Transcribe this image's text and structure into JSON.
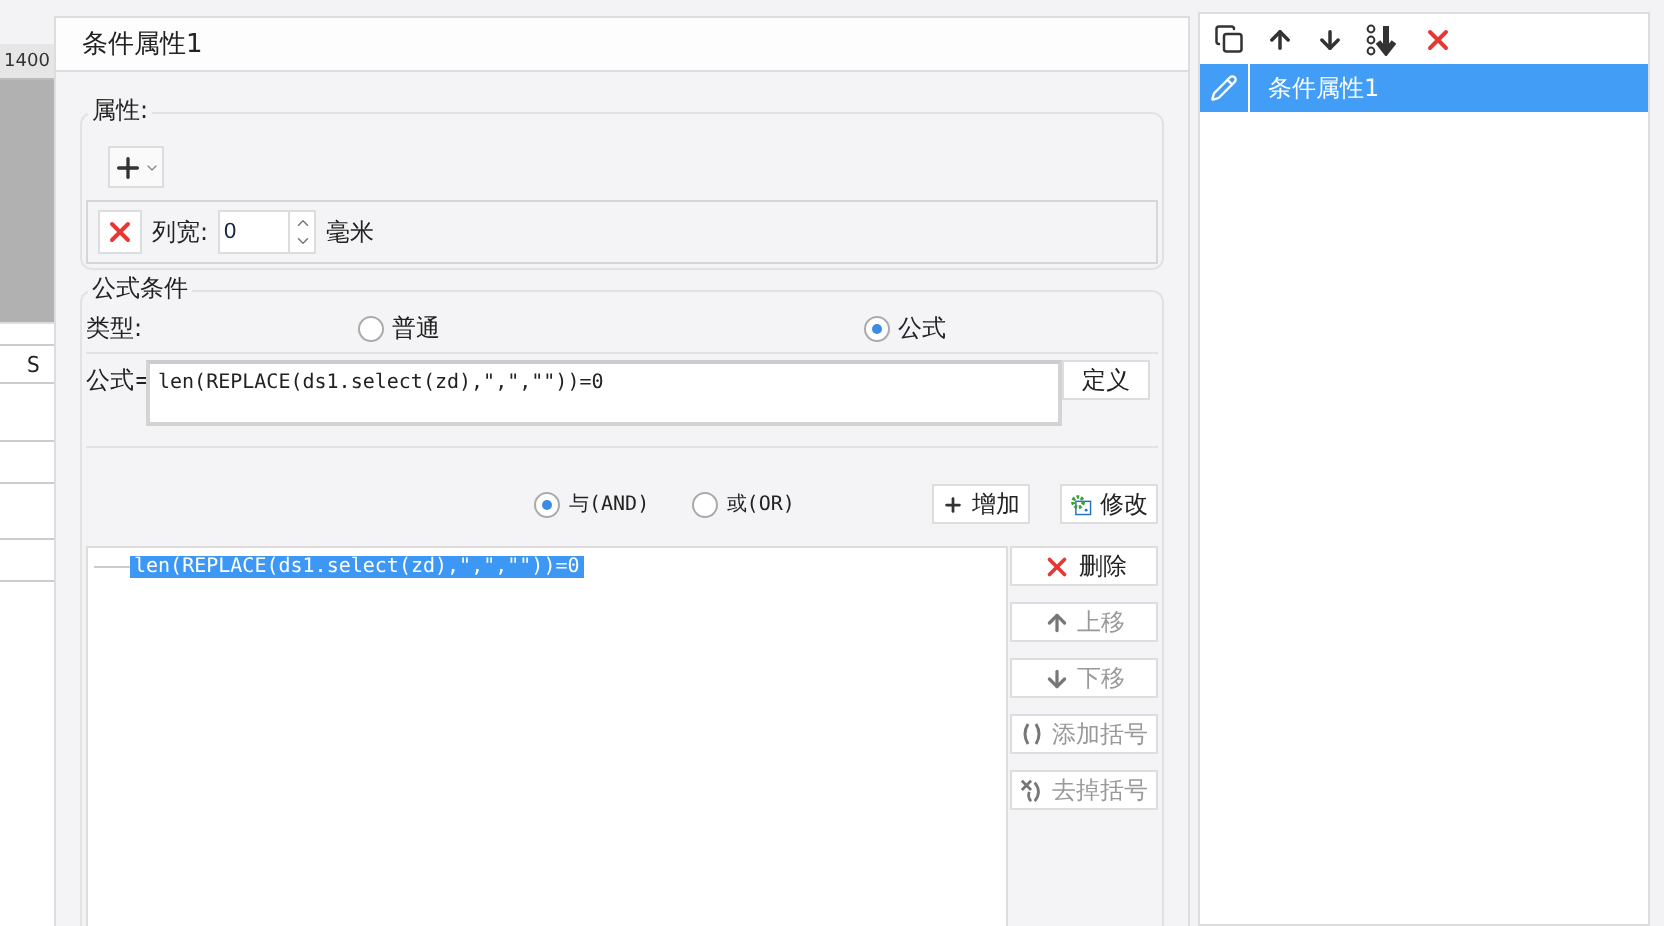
{
  "background_sheet": {
    "ruler_label": "1400",
    "column_header": "S"
  },
  "dialog": {
    "title": "条件属性1",
    "attributes": {
      "legend": "属性:",
      "width_row": {
        "label": "列宽:",
        "value": "0",
        "unit": "毫米"
      }
    },
    "formula_condition": {
      "legend": "公式条件",
      "type_label": "类型:",
      "types": [
        {
          "label": "普通",
          "selected": false
        },
        {
          "label": "公式",
          "selected": true
        }
      ],
      "formula_label": "公式=",
      "formula_value": "len(REPLACE(ds1.select(zd),\",\",\"\"))=0",
      "define_button": "定义",
      "logic": [
        {
          "label": "与(AND)",
          "selected": true
        },
        {
          "label": "或(OR)",
          "selected": false
        }
      ],
      "add_button": "增加",
      "modify_button": "修改",
      "conditions": [
        {
          "text": "len(REPLACE(ds1.select(zd),\",\",\"\"))=0",
          "selected": true
        }
      ],
      "actions": [
        {
          "kind": "delete",
          "label": "删除",
          "disabled": false
        },
        {
          "kind": "up",
          "label": "上移",
          "disabled": true
        },
        {
          "kind": "down",
          "label": "下移",
          "disabled": true
        },
        {
          "kind": "add-paren",
          "label": "添加括号",
          "disabled": true
        },
        {
          "kind": "remove-paren",
          "label": "去掉括号",
          "disabled": true
        }
      ]
    }
  },
  "side_panel": {
    "items": [
      {
        "label": "条件属性1",
        "selected": true
      }
    ]
  }
}
